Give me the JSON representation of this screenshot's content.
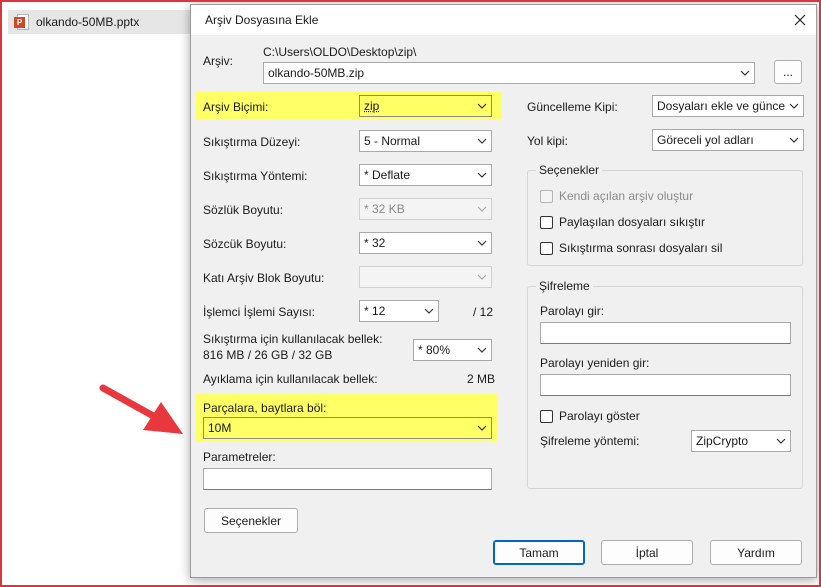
{
  "explorer": {
    "file_name": "olkando-50MB.pptx",
    "file_icon": "powerpoint-file-icon",
    "icon_letter": "P"
  },
  "dialog": {
    "title": "Arşiv Dosyasına Ekle",
    "archive_label": "Arşiv:",
    "archive_path": "C:\\Users\\OLDO\\Desktop\\zip\\",
    "archive_name": "olkando-50MB.zip",
    "browse_label": "...",
    "format_label": "Arşiv Biçimi:",
    "format_value": "zip",
    "level_label": "Sıkıştırma Düzeyi:",
    "level_value": "5 - Normal",
    "method_label": "Sıkıştırma Yöntemi:",
    "method_value": "* Deflate",
    "dict_label": "Sözlük Boyutu:",
    "dict_value": "* 32 KB",
    "word_label": "Sözcük Boyutu:",
    "word_value": "* 32",
    "solid_label": "Katı Arşiv Blok Boyutu:",
    "solid_value": "",
    "threads_label": "İşlemci İşlemi Sayısı:",
    "threads_value": "* 12",
    "threads_total": "/ 12",
    "mem_label_line1": "Sıkıştırma için kullanılacak bellek:",
    "mem_label_line2": "816 MB / 26 GB / 32 GB",
    "mem_value": "* 80%",
    "decomp_label": "Ayıklama için kullanılacak bellek:",
    "decomp_value": "2 MB",
    "split_label": "Parçalara, baytlara böl:",
    "split_value": "10M",
    "params_label": "Parametreler:",
    "params_value": "",
    "options_button": "Seçenekler",
    "update_label": "Güncelleme Kipi:",
    "update_value": "Dosyaları ekle ve güncelle",
    "path_mode_label": "Yol kipi:",
    "path_mode_value": "Göreceli yol adları",
    "options_group": "Seçenekler",
    "opt_sfx": "Kendi açılan arşiv oluştur",
    "opt_shared": "Paylaşılan dosyaları sıkıştır",
    "opt_delete": "Sıkıştırma sonrası dosyaları sil",
    "encryption_group": "Şifreleme",
    "pwd_label": "Parolayı gir:",
    "pwd_value": "",
    "pwd2_label": "Parolayı yeniden gir:",
    "pwd2_value": "",
    "show_pwd_label": "Parolayı göster",
    "enc_method_label": "Şifreleme yöntemi:",
    "enc_method_value": "ZipCrypto",
    "ok_button": "Tamam",
    "cancel_button": "İptal",
    "help_button": "Yardım"
  },
  "colors": {
    "highlight": "#ffff66",
    "annotation_arrow": "#e8383d",
    "frame": "#d9363e",
    "accent": "#0067c0"
  }
}
